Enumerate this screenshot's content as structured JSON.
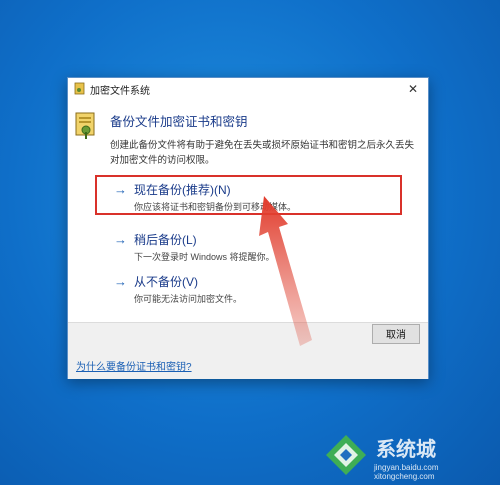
{
  "window": {
    "title": "加密文件系统",
    "close_label": "✕"
  },
  "heading": "备份文件加密证书和密钥",
  "description": "创建此备份文件将有助于避免在丢失或损坏原始证书和密钥之后永久丢失对加密文件的访问权限。",
  "options": [
    {
      "arrow": "→",
      "title": "现在备份(推荐)(N)",
      "subtitle": "你应该将证书和密钥备份到可移动媒体。"
    },
    {
      "arrow": "→",
      "title": "稍后备份(L)",
      "subtitle": "下一次登录时 Windows 将提醒你。"
    },
    {
      "arrow": "→",
      "title": "从不备份(V)",
      "subtitle": "你可能无法访问加密文件。"
    }
  ],
  "footer": {
    "cancel_label": "取消",
    "help_link": "为什么要备份证书和密钥?"
  },
  "watermark": {
    "brand": "系统城",
    "url1": "jingyan.baidu.com",
    "url2": "xitongcheng.com"
  },
  "colors": {
    "desktop": "#0f6fc9",
    "highlight": "#d9312a",
    "link": "#1a5fb4"
  }
}
